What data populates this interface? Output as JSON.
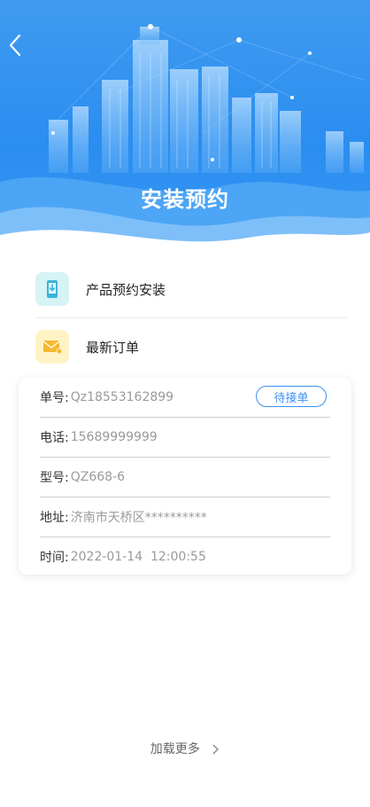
{
  "header": {
    "title": "安装预约"
  },
  "menu": [
    {
      "label": "产品预约安装",
      "icon": "phone-download-icon",
      "icon_bg": "#d6f3f6"
    },
    {
      "label": "最新订单",
      "icon": "mail-icon",
      "icon_bg": "#fff3c6"
    }
  ],
  "order": {
    "number_label": "单号:",
    "number": "Qz18553162899",
    "status": "待接单",
    "phone_label": "电话:",
    "phone": "15689999999",
    "model_label": "型号:",
    "model": "QZ668-6",
    "address_label": "地址:",
    "address": "济南市天桥区**********",
    "time_label": "时间:",
    "time": "2022-01-14  12:00:55"
  },
  "footer": {
    "load_more": "加载更多"
  },
  "colors": {
    "accent": "#3d8ff0",
    "hero_blue": "#2a8df0"
  }
}
